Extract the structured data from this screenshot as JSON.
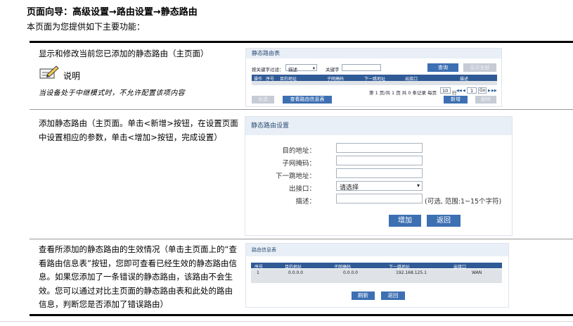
{
  "page": {
    "title": "页面向导：高级设置→路由设置→静态路由",
    "intro": "本页面为您提供如下主要功能："
  },
  "sections": [
    {
      "desc": "显示和修改当前您已添加的静态路由（主页面）",
      "note_label": "说明",
      "note_text": "当设备处于中继模式时，不允许配置该项内容"
    },
    {
      "desc": "添加静态路由（主页面。单击<新增>按钮，在设置页面中设置相应的参数，单击<增加>按钮，完成设置）"
    },
    {
      "desc": "查看所添加的静态路由的生效情况（单击主页面上的“查看路由信息表”按钮，您即可查看已经生效的静态路由信息。如果您添加了一条错误的静态路由，该路由不会生效。您可以通过对比主页面的静态路由表和此处的路由信息，判断您是否添加了错误路由）"
    }
  ],
  "route_table": {
    "header": "静态路由表",
    "filter_label": "按关键字过滤：",
    "filter_value": "描述",
    "keyword_label": "关键字",
    "search": "查询",
    "show_all": "显示全部",
    "columns": [
      "操作",
      "序号",
      "目的地址",
      "子网掩码",
      "下一跳地址",
      "出接口",
      "描述"
    ],
    "pagination": "第 1 页/共 1 页 共 0 条记录 每页",
    "per_page": "10",
    "per_page_suffix": "行",
    "page_input": "1",
    "go": "Go",
    "nav_first": "◀◀",
    "nav_prev": "◀",
    "nav_next": "▶",
    "nav_last": "▶▶",
    "select_all": "全选",
    "view_info": "查看路由信息表",
    "add_new": "新增",
    "delete": "删除"
  },
  "route_setup": {
    "header": "静态路由设置",
    "dest_label": "目的地址：",
    "mask_label": "子网掩码：",
    "nexthop_label": "下一跳地址：",
    "iface_label": "出接口：",
    "iface_value": "请选择",
    "desc_label": "描述：",
    "desc_hint": "(可选, 范围:1~15个字符)",
    "add": "增加",
    "back": "返回"
  },
  "route_info": {
    "header": "路由信息表",
    "columns": [
      "序号",
      "目的地址",
      "子网掩码",
      "下一跳地址",
      "出接口"
    ],
    "rows": [
      [
        "1",
        "0.0.0.0",
        "0.0.0.0",
        "192.168.125.1",
        "WAN"
      ]
    ],
    "refresh": "刷新",
    "back": "返回"
  }
}
